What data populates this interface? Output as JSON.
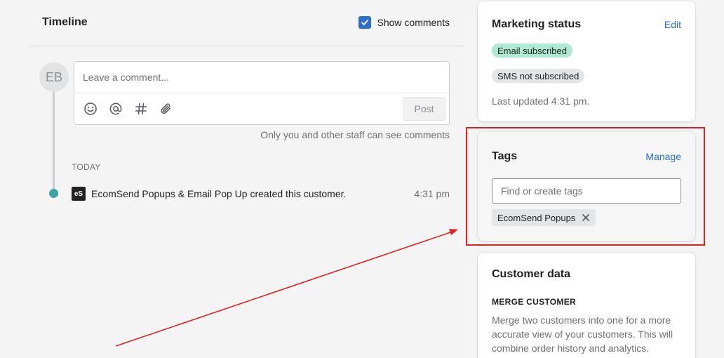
{
  "timeline": {
    "title": "Timeline",
    "show_comments_label": "Show comments",
    "show_comments_checked": true,
    "avatar_initials": "EB",
    "comment_placeholder": "Leave a comment...",
    "post_label": "Post",
    "tool_icons": [
      "emoji-icon",
      "mention-icon",
      "hashtag-icon",
      "attachment-icon"
    ],
    "staff_note": "Only you and other staff can see comments",
    "day_label": "TODAY",
    "events": [
      {
        "logo_text": "eS",
        "text": "EcomSend Popups & Email Pop Up created this customer.",
        "time": "4:31 pm"
      }
    ]
  },
  "marketing": {
    "title": "Marketing status",
    "edit_label": "Edit",
    "email_badge": "Email subscribed",
    "sms_badge": "SMS not subscribed",
    "last_updated": "Last updated 4:31 pm."
  },
  "tags": {
    "title": "Tags",
    "manage_label": "Manage",
    "input_placeholder": "Find or create tags",
    "chips": [
      "EcomSend Popups"
    ]
  },
  "customer_data": {
    "title": "Customer data",
    "merge_label": "MERGE CUSTOMER",
    "merge_text": "Merge two customers into one for a more accurate view of your customers. This will combine order history and analytics."
  },
  "colors": {
    "accent": "#2c6ecb",
    "badge_green": "#aee9d1",
    "timeline_dot": "#3fa2a8",
    "annotation_red": "#e02424"
  }
}
